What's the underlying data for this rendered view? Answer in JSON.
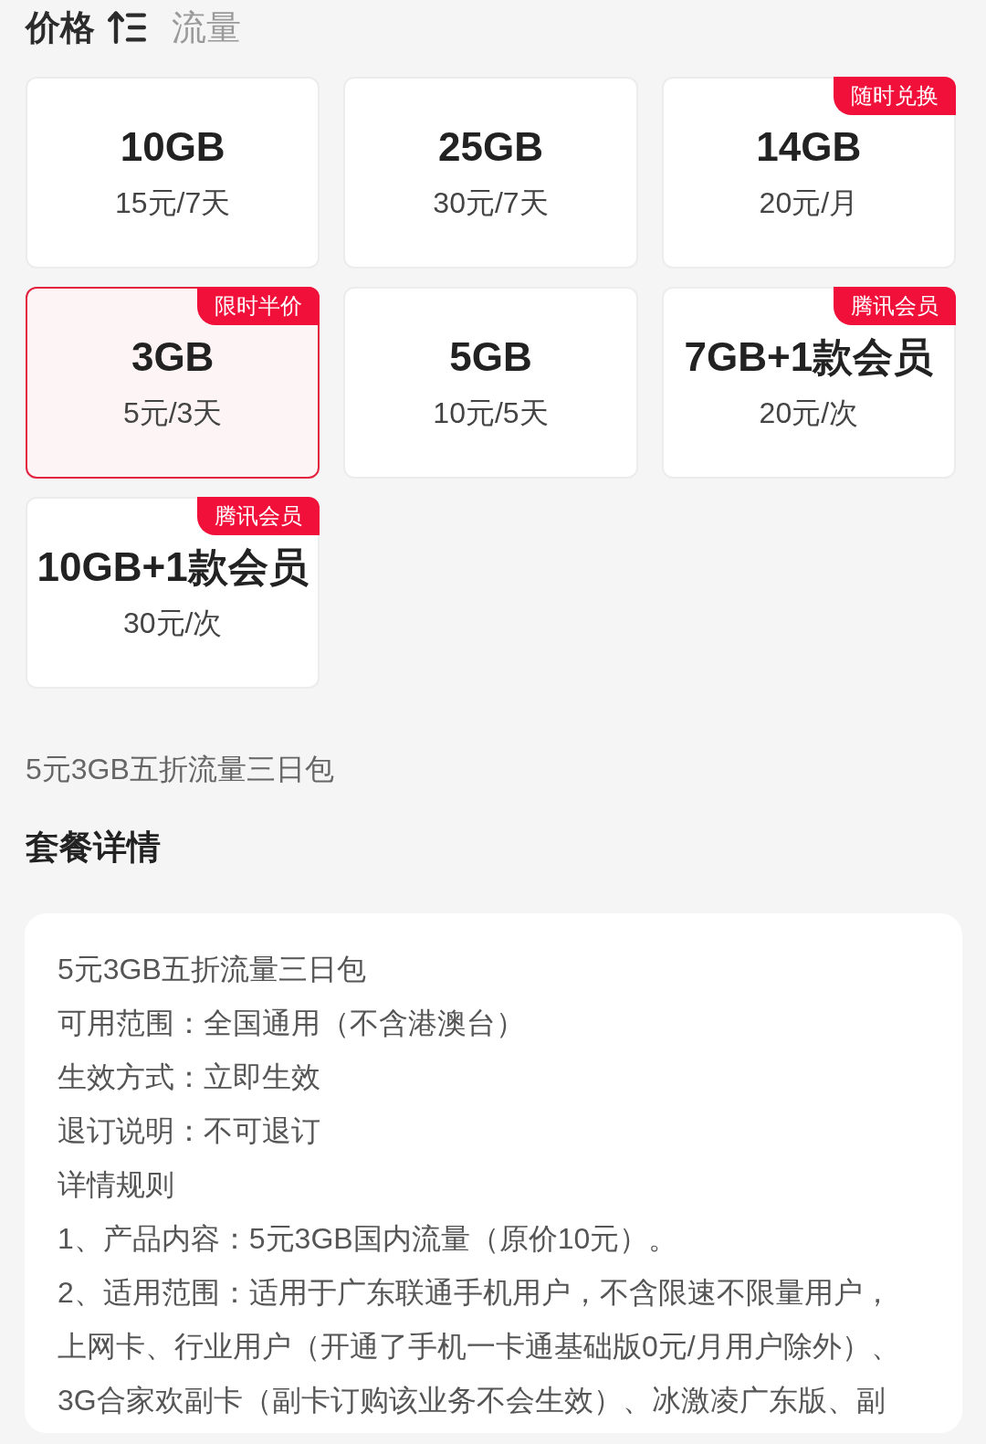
{
  "sort_tabs": [
    {
      "label": "价格",
      "selected": true
    },
    {
      "label": "流量",
      "selected": false
    }
  ],
  "packages": [
    {
      "data": "10GB",
      "price": "15元/7天",
      "selected": false
    },
    {
      "data": "25GB",
      "price": "30元/7天",
      "selected": false
    },
    {
      "data": "14GB",
      "price": "20元/月",
      "tag": "随时兑换",
      "selected": false
    },
    {
      "data": "3GB",
      "price": "5元/3天",
      "tag": "限时半价",
      "selected": true
    },
    {
      "data": "5GB",
      "price": "10元/5天",
      "selected": false
    },
    {
      "data": "7GB+1款会员",
      "price": "20元/次",
      "tag": "腾讯会员",
      "selected": false
    },
    {
      "data": "10GB+1款会员",
      "price": "30元/次",
      "tag": "腾讯会员",
      "selected": false
    }
  ],
  "selected_package_name": "5元3GB五折流量三日包",
  "details": {
    "title": "套餐详情",
    "lines": [
      "5元3GB五折流量三日包",
      "可用范围：全国通用（不含港澳台）",
      "生效方式：立即生效",
      "退订说明：不可退订",
      "详情规则",
      "1、产品内容：5元3GB国内流量（原价10元）。",
      "2、适用范围：适用于广东联通手机用户，不含限速不限量用户，上网卡、行业用户（开通了手机一卡通基础版0元/月用户除外）、3G合家欢副卡（副卡订购该业务不会生效）、冰激凌广东版、副"
    ]
  }
}
